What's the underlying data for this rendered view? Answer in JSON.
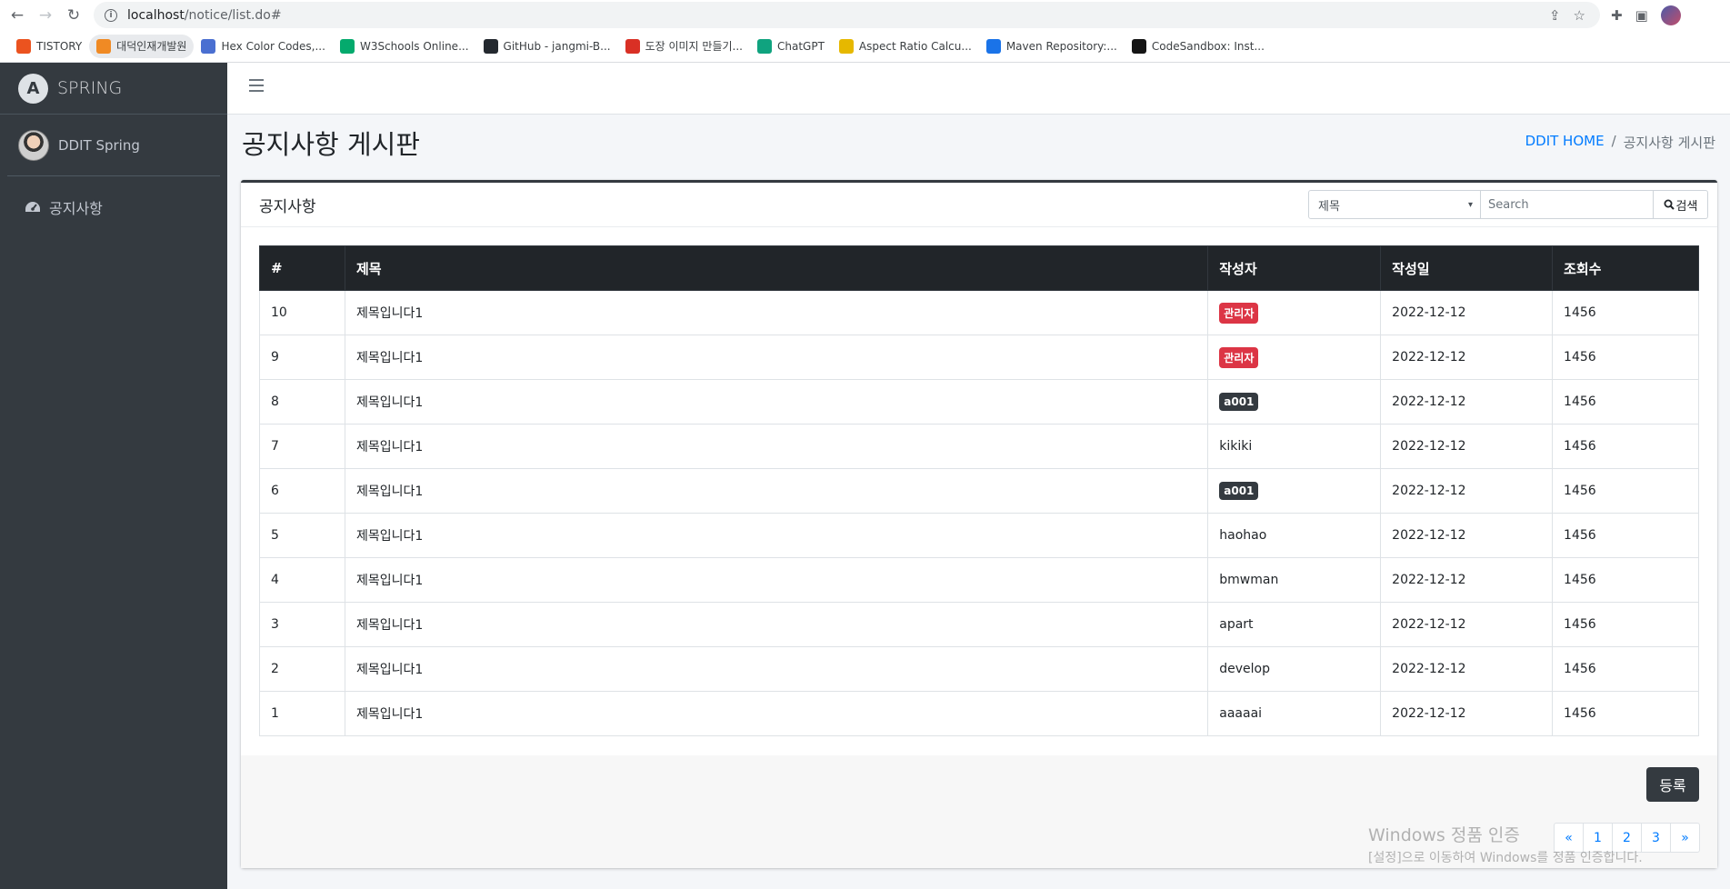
{
  "browser": {
    "url_host": "localhost",
    "url_path": "/notice/list.do#",
    "bookmarks": [
      {
        "label": "TISTORY",
        "color": "#eb531f"
      },
      {
        "label": "대덕인재개발원",
        "color": "#f08a24"
      },
      {
        "label": "Hex Color Codes,...",
        "color": "#4a6fd1"
      },
      {
        "label": "W3Schools Online...",
        "color": "#04aa6d"
      },
      {
        "label": "GitHub - jangmi-B...",
        "color": "#24292f"
      },
      {
        "label": "도장 이미지 만들기...",
        "color": "#d93025"
      },
      {
        "label": "ChatGPT",
        "color": "#10a37f"
      },
      {
        "label": "Aspect Ratio Calcu...",
        "color": "#e6b800"
      },
      {
        "label": "Maven Repository:...",
        "color": "#1a73e8"
      },
      {
        "label": "CodeSandbox: Inst...",
        "color": "#151515"
      }
    ]
  },
  "sidebar": {
    "brand": "SPRING",
    "user": "DDIT Spring",
    "menu": [
      {
        "label": "공지사항",
        "icon": "dashboard-icon"
      }
    ]
  },
  "header": {
    "title": "공지사항 게시판",
    "breadcrumb_home": "DDIT HOME",
    "breadcrumb_sep": "/",
    "breadcrumb_current": "공지사항 게시판"
  },
  "card": {
    "title": "공지사항",
    "search": {
      "select_value": "제목",
      "placeholder": "Search",
      "button_label": "검색"
    },
    "table": {
      "columns": [
        "#",
        "제목",
        "작성자",
        "작성일",
        "조회수"
      ],
      "rows": [
        {
          "no": "10",
          "title": "제목입니다1",
          "writer": "관리자",
          "writer_style": "danger",
          "date": "2022-12-12",
          "hits": "1456"
        },
        {
          "no": "9",
          "title": "제목입니다1",
          "writer": "관리자",
          "writer_style": "danger",
          "date": "2022-12-12",
          "hits": "1456"
        },
        {
          "no": "8",
          "title": "제목입니다1",
          "writer": "a001",
          "writer_style": "dark",
          "date": "2022-12-12",
          "hits": "1456"
        },
        {
          "no": "7",
          "title": "제목입니다1",
          "writer": "kikiki",
          "writer_style": "plain",
          "date": "2022-12-12",
          "hits": "1456"
        },
        {
          "no": "6",
          "title": "제목입니다1",
          "writer": "a001",
          "writer_style": "dark",
          "date": "2022-12-12",
          "hits": "1456"
        },
        {
          "no": "5",
          "title": "제목입니다1",
          "writer": "haohao",
          "writer_style": "plain",
          "date": "2022-12-12",
          "hits": "1456"
        },
        {
          "no": "4",
          "title": "제목입니다1",
          "writer": "bmwman",
          "writer_style": "plain",
          "date": "2022-12-12",
          "hits": "1456"
        },
        {
          "no": "3",
          "title": "제목입니다1",
          "writer": "apart",
          "writer_style": "plain",
          "date": "2022-12-12",
          "hits": "1456"
        },
        {
          "no": "2",
          "title": "제목입니다1",
          "writer": "develop",
          "writer_style": "plain",
          "date": "2022-12-12",
          "hits": "1456"
        },
        {
          "no": "1",
          "title": "제목입니다1",
          "writer": "aaaaai",
          "writer_style": "plain",
          "date": "2022-12-12",
          "hits": "1456"
        }
      ]
    },
    "register_label": "등록",
    "pagination": [
      "«",
      "1",
      "2",
      "3",
      "»"
    ]
  },
  "watermark": {
    "line1": "Windows 정품 인증",
    "line2": "[설정]으로 이동하여 Windows를 정품 인증합니다."
  }
}
